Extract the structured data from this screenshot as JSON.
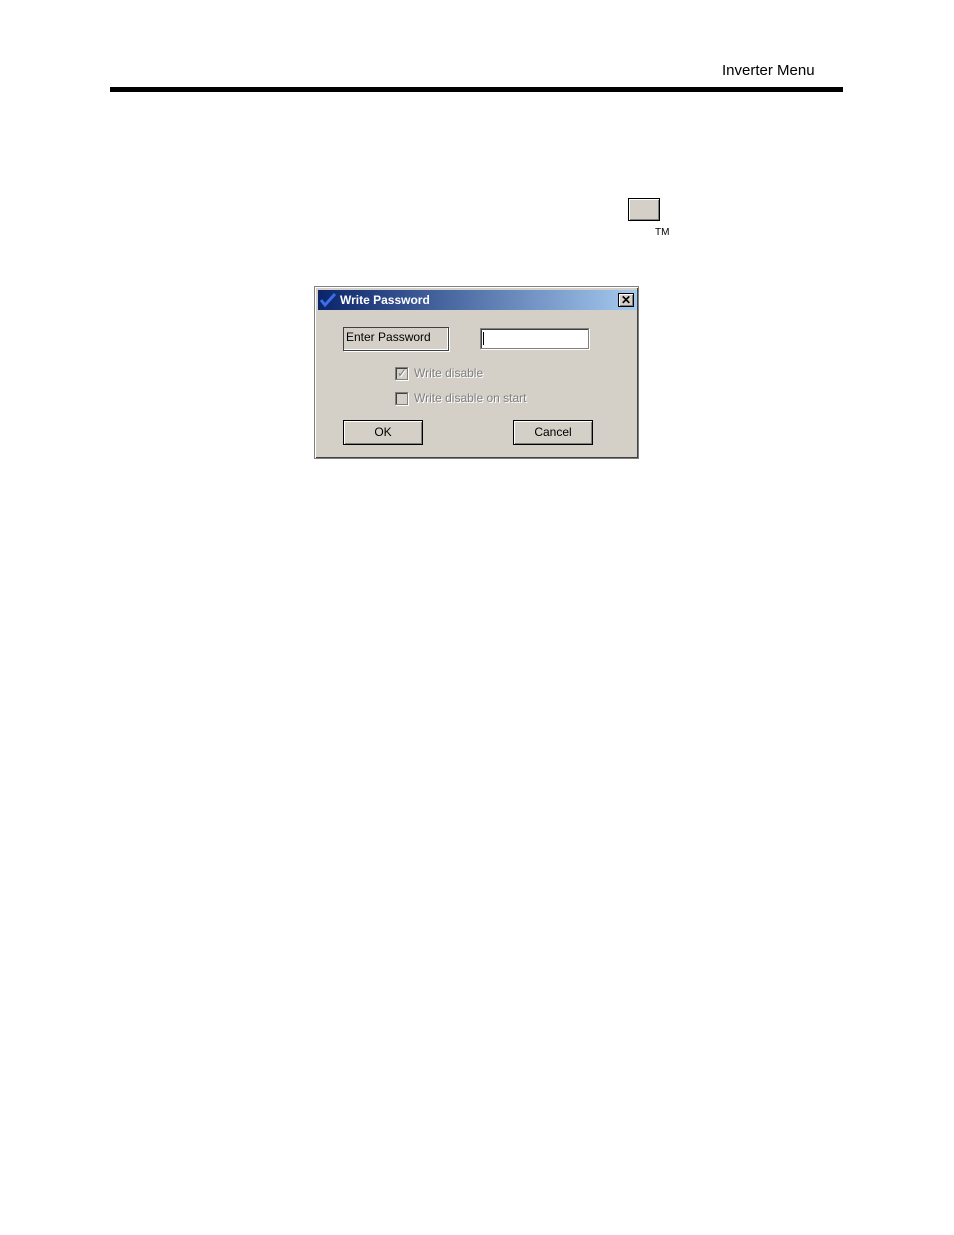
{
  "page": {
    "header_title": "Inverter Menu",
    "trademark": "TM"
  },
  "dialog": {
    "title": "Write Password",
    "close_glyph": "✕",
    "password_label": "Enter Password",
    "password_value": "",
    "write_disable": {
      "label": "Write disable",
      "checked": true,
      "enabled": false
    },
    "write_disable_on_start": {
      "label": "Write disable on start",
      "checked": false,
      "enabled": false
    },
    "ok_label": "OK",
    "cancel_label": "Cancel"
  }
}
